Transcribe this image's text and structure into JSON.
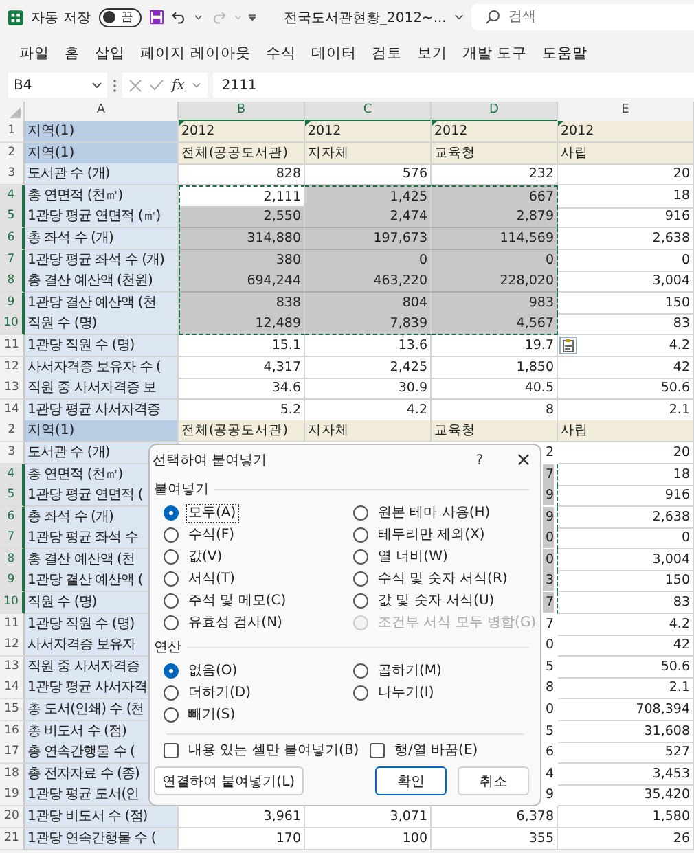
{
  "titlebar": {
    "autosave_label": "자동 저장",
    "autosave": {
      "on": false,
      "text": "끔"
    },
    "redo_disabled": true,
    "filename": "전국도서관현황_2012~...",
    "search": {
      "placeholder": "검색"
    }
  },
  "ribbon_tabs": [
    "파일",
    "홈",
    "삽입",
    "페이지 레이아웃",
    "수식",
    "데이터",
    "검토",
    "보기",
    "개발 도구",
    "도움말"
  ],
  "formula_bar": {
    "name_box": "B4",
    "function_label": "fx",
    "value": "2111"
  },
  "sheet": {
    "columns": [
      {
        "label": "A",
        "selected": false
      },
      {
        "label": "B",
        "selected": true
      },
      {
        "label": "C",
        "selected": true
      },
      {
        "label": "D",
        "selected": true
      },
      {
        "label": "E",
        "selected": false
      }
    ],
    "rows": [
      {
        "num": "1",
        "kind": "header",
        "label": "지역(1)",
        "cells": [
          "2012",
          "2012",
          "2012",
          "2012"
        ],
        "text_numbers": true,
        "copied": false
      },
      {
        "num": "2",
        "kind": "header",
        "label": "지역(1)",
        "cells": [
          "전체(공공도서관)",
          "지자체",
          "교육청",
          "사립"
        ],
        "copied": false
      },
      {
        "num": "3",
        "kind": "data",
        "label": "도서관 수 (개)",
        "cells": [
          "828",
          "576",
          "232",
          "20"
        ],
        "copied": false
      },
      {
        "num": "4",
        "kind": "data",
        "label": "총 연면적 (천㎡)",
        "cells": [
          "2,111",
          "1,425",
          "667",
          "18"
        ],
        "copied": true,
        "active_first": true
      },
      {
        "num": "5",
        "kind": "data",
        "label": "1관당 평균 연면적 (㎡)",
        "cells": [
          "2,550",
          "2,474",
          "2,879",
          "916"
        ],
        "copied": true
      },
      {
        "num": "6",
        "kind": "data",
        "label": "총 좌석 수 (개)",
        "cells": [
          "314,880",
          "197,673",
          "114,569",
          "2,638"
        ],
        "copied": true
      },
      {
        "num": "7",
        "kind": "data",
        "label": "1관당 평균 좌석 수 (개)",
        "cells": [
          "380",
          "0",
          "0",
          "0"
        ],
        "copied": true
      },
      {
        "num": "8",
        "kind": "data",
        "label": "총 결산 예산액 (천원)",
        "cells": [
          "694,244",
          "463,220",
          "228,020",
          "3,004"
        ],
        "copied": true
      },
      {
        "num": "9",
        "kind": "data",
        "label": "1관당 결산 예산액 (천",
        "cells": [
          "838",
          "804",
          "983",
          "150"
        ],
        "copied": true
      },
      {
        "num": "10",
        "kind": "data",
        "label": "직원 수 (명)",
        "cells": [
          "12,489",
          "7,839",
          "4,567",
          "83"
        ],
        "copied": true
      },
      {
        "num": "11",
        "kind": "data",
        "label": "1관당 직원 수 (명)",
        "cells": [
          "15.1",
          "13.6",
          "19.7",
          "4.2"
        ],
        "copied": false,
        "paste_options": true
      },
      {
        "num": "12",
        "kind": "data",
        "label": "사서자격증 보유자 수 (",
        "cells": [
          "4,317",
          "2,425",
          "1,850",
          "42"
        ],
        "copied": false
      },
      {
        "num": "13",
        "kind": "data",
        "label": "직원 중 사서자격증 보",
        "cells": [
          "34.6",
          "30.9",
          "40.5",
          "50.6"
        ],
        "copied": false
      },
      {
        "num": "14",
        "kind": "data",
        "label": "1관당 평균 사서자격증",
        "cells": [
          "5.2",
          "4.2",
          "8",
          "2.1"
        ],
        "copied": false
      },
      {
        "num": "2",
        "kind": "header",
        "label": "지역(1)",
        "cells": [
          "전체(공공도서관)",
          "지자체",
          "교육청",
          "사립"
        ],
        "copied": false
      },
      {
        "num": "3",
        "kind": "covered",
        "label": "도서관 수 (개)",
        "d_tail": "2",
        "e": "20",
        "copied": false
      },
      {
        "num": "4",
        "kind": "covered",
        "label": "총 연면적 (천㎡)",
        "d_tail": "7",
        "e": "18",
        "copied": true
      },
      {
        "num": "5",
        "kind": "covered",
        "label": "1관당 평균 연면적 (",
        "d_tail": "9",
        "e": "916",
        "copied": true
      },
      {
        "num": "6",
        "kind": "covered",
        "label": "총 좌석 수 (개)",
        "d_tail": "9",
        "e": "2,638",
        "copied": true
      },
      {
        "num": "7",
        "kind": "covered",
        "label": "1관당 평균 좌석 수",
        "d_tail": "0",
        "e": "0",
        "copied": true
      },
      {
        "num": "8",
        "kind": "covered",
        "label": "총 결산 예산액 (천",
        "d_tail": "0",
        "e": "3,004",
        "copied": true
      },
      {
        "num": "9",
        "kind": "covered",
        "label": "1관당 결산 예산액 (",
        "d_tail": "3",
        "e": "150",
        "copied": true
      },
      {
        "num": "10",
        "kind": "covered",
        "label": "직원 수 (명)",
        "d_tail": "7",
        "e": "83",
        "copied": true
      },
      {
        "num": "11",
        "kind": "covered",
        "label": "1관당 직원 수 (명)",
        "d_tail": "7",
        "e": "4.2",
        "copied": false
      },
      {
        "num": "12",
        "kind": "covered",
        "label": "사서자격증 보유자",
        "d_tail": "0",
        "e": "42",
        "copied": false
      },
      {
        "num": "13",
        "kind": "covered",
        "label": "직원 중 사서자격증",
        "d_tail": "5",
        "e": "50.6",
        "copied": false
      },
      {
        "num": "14",
        "kind": "covered",
        "label": "1관당 평균 사서자격",
        "d_tail": "8",
        "e": "2.1",
        "copied": false
      },
      {
        "num": "15",
        "kind": "covered",
        "label": "총 도서(인쇄) 수 (천",
        "d_tail": "0",
        "e": "708,394",
        "copied": false
      },
      {
        "num": "16",
        "kind": "covered",
        "label": "총 비도서 수 (점)",
        "d_tail": "5",
        "e": "31,608",
        "copied": false
      },
      {
        "num": "17",
        "kind": "covered",
        "label": "총 연속간행물 수 (",
        "d_tail": "6",
        "e": "527",
        "copied": false
      },
      {
        "num": "18",
        "kind": "covered",
        "label": "총 전자자료 수 (종)",
        "d_tail": "4",
        "e": "3,453",
        "copied": false
      },
      {
        "num": "19",
        "kind": "covered",
        "label": "1관당 평균 도서(인",
        "d_tail": "9",
        "e": "35,420",
        "copied": false
      },
      {
        "num": "20",
        "kind": "data",
        "label": "1관당 비도서 수 (점)",
        "cells": [
          "3,961",
          "3,071",
          "6,378",
          "1,580"
        ],
        "copied": false
      },
      {
        "num": "21",
        "kind": "data",
        "label": "1관당 연속간행물 수 (",
        "cells": [
          "170",
          "100",
          "355",
          "26"
        ],
        "copied": false
      }
    ]
  },
  "dialog": {
    "title": "선택하여 붙여넣기",
    "help": "?",
    "close": "×",
    "sections": [
      {
        "heading": "붙여넣기",
        "options": [
          {
            "label": "모두(A)",
            "selected": true,
            "focused": true,
            "disabled": false
          },
          {
            "label": "원본 테마 사용(H)",
            "selected": false,
            "focused": false,
            "disabled": false
          },
          {
            "label": "수식(F)",
            "selected": false,
            "focused": false,
            "disabled": false
          },
          {
            "label": "테두리만 제외(X)",
            "selected": false,
            "focused": false,
            "disabled": false
          },
          {
            "label": "값(V)",
            "selected": false,
            "focused": false,
            "disabled": false
          },
          {
            "label": "열 너비(W)",
            "selected": false,
            "focused": false,
            "disabled": false
          },
          {
            "label": "서식(T)",
            "selected": false,
            "focused": false,
            "disabled": false
          },
          {
            "label": "수식 및 숫자 서식(R)",
            "selected": false,
            "focused": false,
            "disabled": false
          },
          {
            "label": "주석 및 메모(C)",
            "selected": false,
            "focused": false,
            "disabled": false
          },
          {
            "label": "값 및 숫자 서식(U)",
            "selected": false,
            "focused": false,
            "disabled": false
          },
          {
            "label": "유효성 검사(N)",
            "selected": false,
            "focused": false,
            "disabled": false
          },
          {
            "label": "조건부 서식 모두 병합(G)",
            "selected": false,
            "focused": false,
            "disabled": true
          }
        ]
      },
      {
        "heading": "연산",
        "options": [
          {
            "label": "없음(O)",
            "selected": true,
            "focused": false,
            "disabled": false
          },
          {
            "label": "곱하기(M)",
            "selected": false,
            "focused": false,
            "disabled": false
          },
          {
            "label": "더하기(D)",
            "selected": false,
            "focused": false,
            "disabled": false
          },
          {
            "label": "나누기(I)",
            "selected": false,
            "focused": false,
            "disabled": false
          },
          {
            "label": "빼기(S)",
            "selected": false,
            "focused": false,
            "disabled": false
          }
        ]
      }
    ],
    "checkboxes": [
      {
        "label": "내용 있는 셀만 붙여넣기(B)",
        "checked": false
      },
      {
        "label": "행/열 바꿈(E)",
        "checked": false
      }
    ],
    "buttons": [
      {
        "label": "연결하여 붙여넣기(L)",
        "kind": "secondary"
      },
      {
        "label": "확인",
        "kind": "default"
      },
      {
        "label": "취소",
        "kind": "secondary"
      }
    ]
  }
}
